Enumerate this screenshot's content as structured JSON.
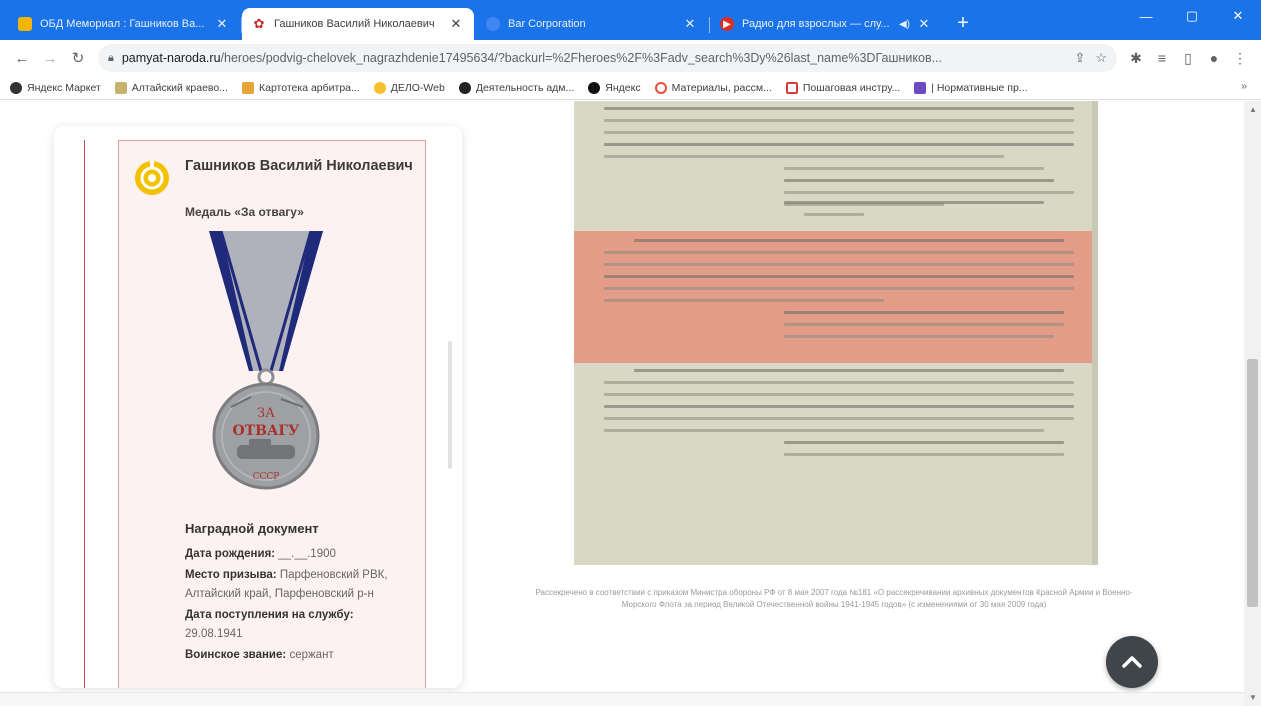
{
  "browser": {
    "tabs": [
      {
        "title": "ОБД Мемориал : Гашников Ва...",
        "favicon_color": "#f4b400",
        "active": false,
        "extra": ""
      },
      {
        "title": "Гашников Василий Николаевич",
        "favicon_color": "#c62828",
        "active": true,
        "extra": ""
      },
      {
        "title": "Bar Corporation",
        "favicon_color": "#4285f4",
        "active": false,
        "extra": ""
      },
      {
        "title": "Радио для взрослых — слу...",
        "favicon_color": "#d93025",
        "active": false,
        "extra": "◀)"
      }
    ],
    "new_tab": "+",
    "window_controls": {
      "minimize": "—",
      "maximize": "▢",
      "close": "✕"
    },
    "address": {
      "host": "pamyat-naroda.ru",
      "path": "/heroes/podvig-chelovek_nagrazhdenie17495634/?backurl=%2Fheroes%2F%3Fadv_search%3Dy%26last_name%3DГашников..."
    },
    "bookmarks": [
      {
        "label": "Яндекс Маркет",
        "color": "#333333"
      },
      {
        "label": "Алтайский краево...",
        "color": "#c9b26b"
      },
      {
        "label": "Картотека арбитра...",
        "color": "#e5a33a"
      },
      {
        "label": "ДЕЛО-Web",
        "color": "#f5c02f"
      },
      {
        "label": "Деятельность адм...",
        "color": "#222222"
      },
      {
        "label": "Яндекс",
        "color": "#111111"
      },
      {
        "label": "Материалы, рассм...",
        "color": "#e94b3c"
      },
      {
        "label": "Пошаговая инстру...",
        "color": "#d93b3b"
      },
      {
        "label": "| Нормативные пр...",
        "color": "#6a4bc4"
      }
    ]
  },
  "hero": {
    "name": "Гашников Василий Николаевич",
    "award": "Медаль «За отвагу»",
    "document_title": "Наградной документ",
    "fields": [
      {
        "label": "Дата рождения:",
        "value": "__.__.1900"
      },
      {
        "label": "Место призыва:",
        "value": "Парфеновский РВК, Алтайский край, Парфеновский р-н"
      },
      {
        "label": "Дата поступления на службу:",
        "value": "29.08.1941"
      },
      {
        "label": "Воинское звание:",
        "value": "сержант"
      }
    ]
  },
  "medal": {
    "ribbon_color": "#b0b2bb",
    "stripe_color": "#1f2a7a",
    "coin_color": "#9fa0a3",
    "inscription_top": "ЗА",
    "inscription_main": "ОТВАГУ",
    "inscription_bottom": "СССР"
  },
  "scan": {
    "paper_color": "#d9d8c4",
    "highlight_color": "#e39c87",
    "note": "Рассекречено в соответствии с приказом Министра обороны РФ от 8 мая 2007 года №181 «О рассекречивании архивных документов Красной Армии и Военно-Морского Флота за период Великой Отечественной войны 1941-1945 годов» (с изменениями от 30 мая 2009 года)"
  },
  "colors": {
    "accent": "#1a73e8",
    "card_border": "#c94a4a",
    "card_bg": "#fdf1f1",
    "to_top_bg": "#3f4548"
  }
}
